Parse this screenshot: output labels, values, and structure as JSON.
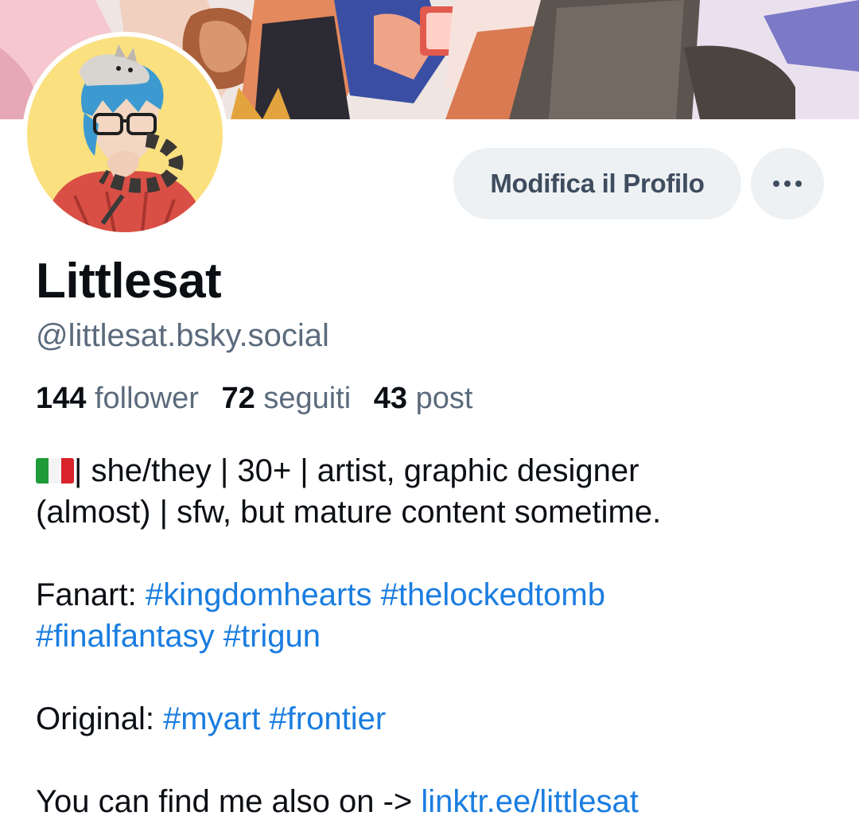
{
  "profile": {
    "display_name": "Littlesat",
    "handle": "@littlesat.bsky.social"
  },
  "actions": {
    "edit_label": "Modifica il Profilo",
    "more_icon": "ellipsis-icon"
  },
  "stats": {
    "followers_count": "144",
    "followers_label": "follower",
    "following_count": "72",
    "following_label": "seguiti",
    "posts_count": "43",
    "posts_label": "post"
  },
  "bio": {
    "line1_text": "| she/they | 30+ | artist, graphic designer",
    "line2_text": "(almost) | sfw, but mature content sometime.",
    "fanart_label": "Fanart: ",
    "fanart_tags_line1": [
      "#kingdomhearts",
      "#thelockedtomb"
    ],
    "fanart_tags_line2": [
      "#finalfantasy",
      "#trigun"
    ],
    "original_label": "Original: ",
    "original_tags": [
      "#myart",
      "#frontier"
    ],
    "links_label": "You can find me also on -> ",
    "link_text": "linktr.ee/littlesat"
  },
  "colors": {
    "accent": "#1a7de0",
    "muted": "#5b6b7c",
    "button_bg": "#eef1f4",
    "button_text": "#3e4c5e",
    "avatar_bg": "#fbe080",
    "flag_green": "#1f9b3a",
    "flag_white": "#f4f4f4",
    "flag_red": "#d8232a"
  }
}
